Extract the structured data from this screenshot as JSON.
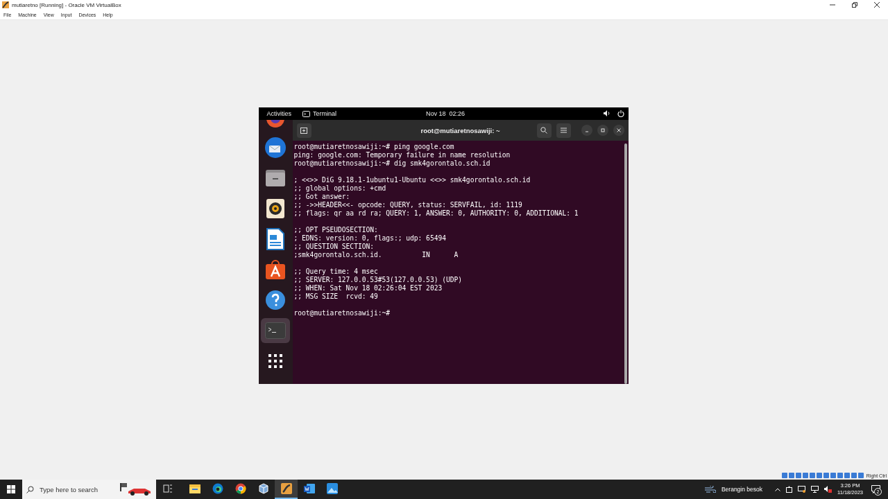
{
  "window": {
    "title": "mutiaretno [Running] - Oracle VM VirtualBox"
  },
  "menu": [
    "File",
    "Machine",
    "View",
    "Input",
    "Devices",
    "Help"
  ],
  "guest": {
    "top_bar": {
      "activities": "Activities",
      "app": "Terminal",
      "clock": "Nov 18  02:26"
    },
    "dock": [
      {
        "kind": "browser",
        "selected": false
      },
      {
        "kind": "mail",
        "selected": false
      },
      {
        "kind": "files",
        "selected": false
      },
      {
        "kind": "music",
        "selected": false
      },
      {
        "kind": "writer",
        "selected": false
      },
      {
        "kind": "store",
        "selected": false
      },
      {
        "kind": "help",
        "selected": false
      },
      {
        "kind": "terminal",
        "selected": true
      },
      {
        "kind": "apps",
        "selected": false
      }
    ],
    "terminal": {
      "title": "root@mutiaretnosawiji: ~",
      "blocks": [
        [
          "root@mutiaretnosawiji:~# ping google.com",
          "ping: google.com: Temporary failure in name resolution",
          "root@mutiaretnosawiji:~# dig smk4gorontalo.sch.id"
        ],
        [
          "; <<>> DiG 9.18.1-1ubuntu1-Ubuntu <<>> smk4gorontalo.sch.id",
          ";; global options: +cmd",
          ";; Got answer:",
          ";; ->>HEADER<<- opcode: QUERY, status: SERVFAIL, id: 1119",
          ";; flags: qr aa rd ra; QUERY: 1, ANSWER: 0, AUTHORITY: 0, ADDITIONAL: 1"
        ],
        [
          ";; OPT PSEUDOSECTION:",
          "; EDNS: version: 0, flags:; udp: 65494",
          ";; QUESTION SECTION:",
          ";smk4gorontalo.sch.id.          IN      A"
        ],
        [
          ";; Query time: 4 msec",
          ";; SERVER: 127.0.0.53#53(127.0.0.53) (UDP)",
          ";; WHEN: Sat Nov 18 02:26:04 EST 2023",
          ";; MSG SIZE  rcvd: 49"
        ],
        [
          "root@mutiaretnosawiji:~#"
        ]
      ]
    }
  },
  "host_status": {
    "key": "Right Ctrl"
  },
  "taskbar": {
    "search_placeholder": "Type here to search",
    "apps": [
      {
        "kind": "task-view",
        "selected": false
      },
      {
        "kind": "folder",
        "selected": false
      },
      {
        "kind": "edge",
        "selected": false
      },
      {
        "kind": "chrome",
        "selected": false
      },
      {
        "kind": "vbox",
        "selected": false
      },
      {
        "kind": "vm",
        "selected": true
      },
      {
        "kind": "word",
        "selected": false
      },
      {
        "kind": "photos",
        "selected": false
      }
    ],
    "weather": "Berangin besok",
    "time": "3:26 PM",
    "date": "11/18/2023",
    "notifications": "2"
  }
}
